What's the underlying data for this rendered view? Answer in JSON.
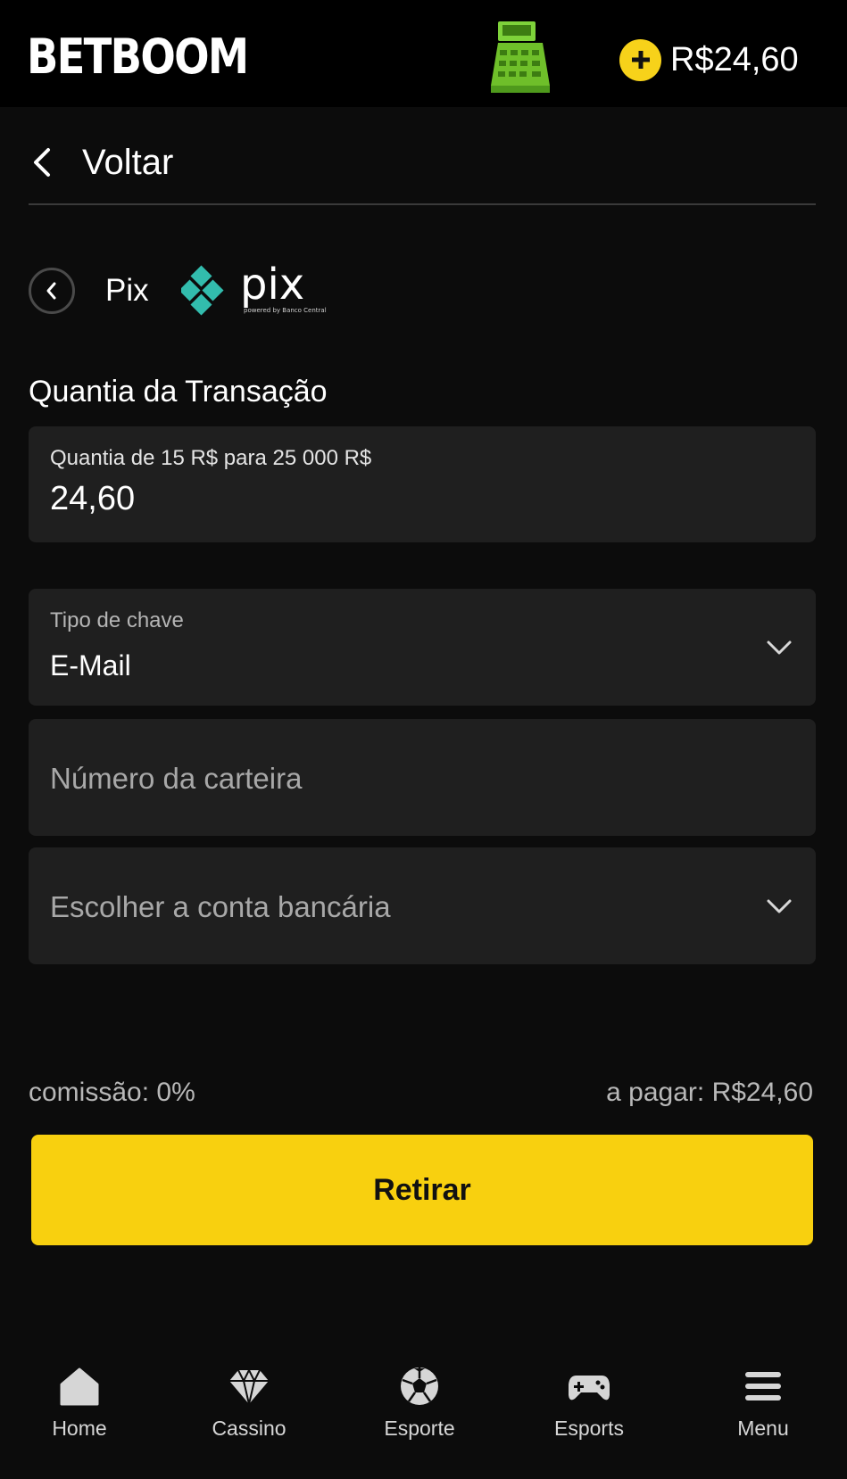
{
  "header": {
    "brand": "BETBOOM",
    "balance": "R$24,60"
  },
  "nav": {
    "back_label": "Voltar"
  },
  "method": {
    "name": "Pix",
    "logo_text": "pix",
    "logo_subtext": "powered by Banco Central"
  },
  "form": {
    "section_title": "Quantia da Transação",
    "amount_label": "Quantia de 15 R$ para 25 000 R$",
    "amount_value": "24,60",
    "key_type_label": "Tipo de chave",
    "key_type_value": "E-Mail",
    "wallet_placeholder": "Número da carteira",
    "bank_account_placeholder": "Escolher a conta bancária"
  },
  "summary": {
    "commission": "comissão: 0%",
    "to_pay": "a pagar: R$24,60"
  },
  "actions": {
    "withdraw_label": "Retirar"
  },
  "bottom_nav": {
    "items": [
      {
        "label": "Home",
        "icon": "home-icon"
      },
      {
        "label": "Cassino",
        "icon": "diamond-icon"
      },
      {
        "label": "Esporte",
        "icon": "soccer-ball-icon"
      },
      {
        "label": "Esports",
        "icon": "gamepad-icon"
      },
      {
        "label": "Menu",
        "icon": "menu-icon"
      }
    ]
  },
  "colors": {
    "accent": "#f8d00f",
    "background": "#0c0c0c",
    "field_bg": "#1f1f1f",
    "pix_teal": "#32bcad"
  }
}
